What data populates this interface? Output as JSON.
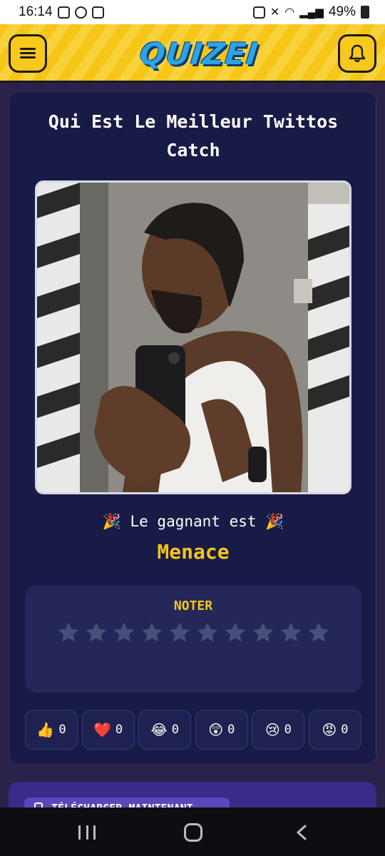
{
  "status_bar": {
    "time": "16:14",
    "battery": "49%"
  },
  "header": {
    "logo": "QUIZEI",
    "menu_icon": "hamburger-menu-icon",
    "bell_icon": "bell-icon"
  },
  "quiz": {
    "title": "Qui Est Le Meilleur Twittos Catch",
    "winner_line": "🎉 Le gagnant est 🎉",
    "winner_name": "Menace"
  },
  "rating": {
    "label": "NOTER",
    "max_stars": 10,
    "selected_stars": 0,
    "star_color": "#4a4f7a"
  },
  "reactions": [
    {
      "emoji": "👍",
      "count": "0"
    },
    {
      "emoji": "❤️",
      "count": "0"
    },
    {
      "emoji": "😂",
      "count": "0"
    },
    {
      "emoji": "😲",
      "count": "0"
    },
    {
      "emoji": "😢",
      "count": "0"
    },
    {
      "emoji": "😡",
      "count": "0"
    }
  ],
  "download": {
    "label": "TÉLÉCHARGER MAINTENANT"
  },
  "colors": {
    "accent": "#f5c518",
    "card_bg": "#181b45",
    "page_bg": "#2a2248"
  }
}
